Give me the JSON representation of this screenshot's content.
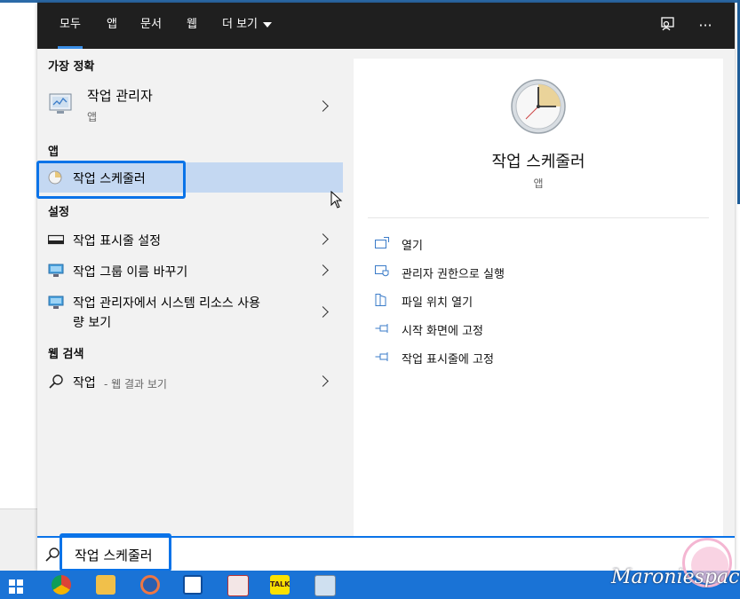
{
  "tabs": [
    {
      "label": "모두",
      "active": true
    },
    {
      "label": "앱"
    },
    {
      "label": "문서"
    },
    {
      "label": "웹"
    },
    {
      "label": "더 보기"
    }
  ],
  "best_match": {
    "header": "가장 정확",
    "title": "작업 관리자",
    "sub": "앱"
  },
  "apps": {
    "header": "앱",
    "item": "작업 스케줄러"
  },
  "settings": {
    "header": "설정",
    "items": [
      "작업 표시줄 설정",
      "작업 그룹 이름 바꾸기",
      "작업 관리자에서 시스템 리소스 사용",
      "량 보기"
    ]
  },
  "web": {
    "header": "웹 검색",
    "query": "작업",
    "suffix": "- 웹 결과 보기"
  },
  "detail": {
    "title": "작업 스케줄러",
    "sub": "앱",
    "actions": [
      "열기",
      "관리자 권한으로 실행",
      "파일 위치 열기",
      "시작 화면에 고정",
      "작업 표시줄에 고정"
    ]
  },
  "search": {
    "value": "작업 스케줄러"
  },
  "colors": {
    "accent": "#0a73e8",
    "selection": "#c4d8f2",
    "taskbar": "#1a73d6",
    "topbar": "#1f1f1f"
  },
  "watermark": "Maroniespace"
}
